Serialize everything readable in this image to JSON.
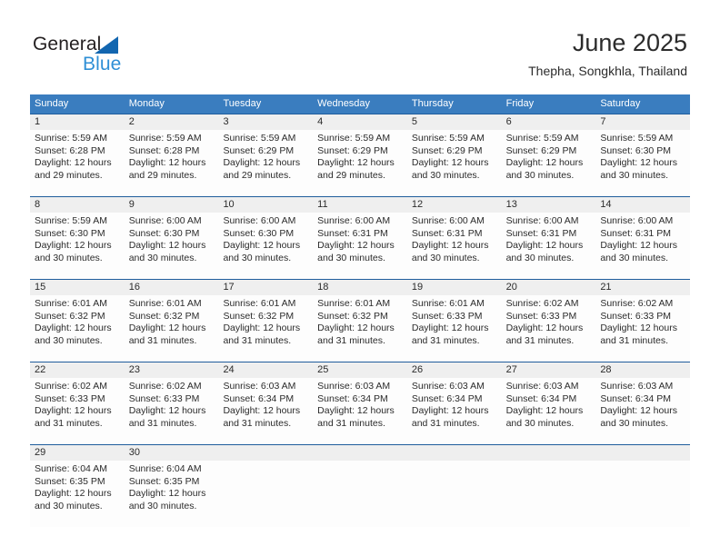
{
  "brand": {
    "name_part1": "General",
    "name_part2": "Blue",
    "triangle_color": "#1266b0",
    "blue_text_color": "#2f8fd6"
  },
  "header": {
    "title": "June 2025",
    "subtitle": "Thepha, Songkhla, Thailand"
  },
  "colors": {
    "header_band": "#3a7dbf",
    "week_separator": "#1f5d9c",
    "day_number_band": "#efefef",
    "text": "#2b2b2b"
  },
  "weekdays": [
    "Sunday",
    "Monday",
    "Tuesday",
    "Wednesday",
    "Thursday",
    "Friday",
    "Saturday"
  ],
  "weeks": [
    {
      "days": [
        {
          "number": "1",
          "sunrise": "Sunrise: 5:59 AM",
          "sunset": "Sunset: 6:28 PM",
          "daylight_line1": "Daylight: 12 hours",
          "daylight_line2": "and 29 minutes."
        },
        {
          "number": "2",
          "sunrise": "Sunrise: 5:59 AM",
          "sunset": "Sunset: 6:28 PM",
          "daylight_line1": "Daylight: 12 hours",
          "daylight_line2": "and 29 minutes."
        },
        {
          "number": "3",
          "sunrise": "Sunrise: 5:59 AM",
          "sunset": "Sunset: 6:29 PM",
          "daylight_line1": "Daylight: 12 hours",
          "daylight_line2": "and 29 minutes."
        },
        {
          "number": "4",
          "sunrise": "Sunrise: 5:59 AM",
          "sunset": "Sunset: 6:29 PM",
          "daylight_line1": "Daylight: 12 hours",
          "daylight_line2": "and 29 minutes."
        },
        {
          "number": "5",
          "sunrise": "Sunrise: 5:59 AM",
          "sunset": "Sunset: 6:29 PM",
          "daylight_line1": "Daylight: 12 hours",
          "daylight_line2": "and 30 minutes."
        },
        {
          "number": "6",
          "sunrise": "Sunrise: 5:59 AM",
          "sunset": "Sunset: 6:29 PM",
          "daylight_line1": "Daylight: 12 hours",
          "daylight_line2": "and 30 minutes."
        },
        {
          "number": "7",
          "sunrise": "Sunrise: 5:59 AM",
          "sunset": "Sunset: 6:30 PM",
          "daylight_line1": "Daylight: 12 hours",
          "daylight_line2": "and 30 minutes."
        }
      ]
    },
    {
      "days": [
        {
          "number": "8",
          "sunrise": "Sunrise: 5:59 AM",
          "sunset": "Sunset: 6:30 PM",
          "daylight_line1": "Daylight: 12 hours",
          "daylight_line2": "and 30 minutes."
        },
        {
          "number": "9",
          "sunrise": "Sunrise: 6:00 AM",
          "sunset": "Sunset: 6:30 PM",
          "daylight_line1": "Daylight: 12 hours",
          "daylight_line2": "and 30 minutes."
        },
        {
          "number": "10",
          "sunrise": "Sunrise: 6:00 AM",
          "sunset": "Sunset: 6:30 PM",
          "daylight_line1": "Daylight: 12 hours",
          "daylight_line2": "and 30 minutes."
        },
        {
          "number": "11",
          "sunrise": "Sunrise: 6:00 AM",
          "sunset": "Sunset: 6:31 PM",
          "daylight_line1": "Daylight: 12 hours",
          "daylight_line2": "and 30 minutes."
        },
        {
          "number": "12",
          "sunrise": "Sunrise: 6:00 AM",
          "sunset": "Sunset: 6:31 PM",
          "daylight_line1": "Daylight: 12 hours",
          "daylight_line2": "and 30 minutes."
        },
        {
          "number": "13",
          "sunrise": "Sunrise: 6:00 AM",
          "sunset": "Sunset: 6:31 PM",
          "daylight_line1": "Daylight: 12 hours",
          "daylight_line2": "and 30 minutes."
        },
        {
          "number": "14",
          "sunrise": "Sunrise: 6:00 AM",
          "sunset": "Sunset: 6:31 PM",
          "daylight_line1": "Daylight: 12 hours",
          "daylight_line2": "and 30 minutes."
        }
      ]
    },
    {
      "days": [
        {
          "number": "15",
          "sunrise": "Sunrise: 6:01 AM",
          "sunset": "Sunset: 6:32 PM",
          "daylight_line1": "Daylight: 12 hours",
          "daylight_line2": "and 30 minutes."
        },
        {
          "number": "16",
          "sunrise": "Sunrise: 6:01 AM",
          "sunset": "Sunset: 6:32 PM",
          "daylight_line1": "Daylight: 12 hours",
          "daylight_line2": "and 31 minutes."
        },
        {
          "number": "17",
          "sunrise": "Sunrise: 6:01 AM",
          "sunset": "Sunset: 6:32 PM",
          "daylight_line1": "Daylight: 12 hours",
          "daylight_line2": "and 31 minutes."
        },
        {
          "number": "18",
          "sunrise": "Sunrise: 6:01 AM",
          "sunset": "Sunset: 6:32 PM",
          "daylight_line1": "Daylight: 12 hours",
          "daylight_line2": "and 31 minutes."
        },
        {
          "number": "19",
          "sunrise": "Sunrise: 6:01 AM",
          "sunset": "Sunset: 6:33 PM",
          "daylight_line1": "Daylight: 12 hours",
          "daylight_line2": "and 31 minutes."
        },
        {
          "number": "20",
          "sunrise": "Sunrise: 6:02 AM",
          "sunset": "Sunset: 6:33 PM",
          "daylight_line1": "Daylight: 12 hours",
          "daylight_line2": "and 31 minutes."
        },
        {
          "number": "21",
          "sunrise": "Sunrise: 6:02 AM",
          "sunset": "Sunset: 6:33 PM",
          "daylight_line1": "Daylight: 12 hours",
          "daylight_line2": "and 31 minutes."
        }
      ]
    },
    {
      "days": [
        {
          "number": "22",
          "sunrise": "Sunrise: 6:02 AM",
          "sunset": "Sunset: 6:33 PM",
          "daylight_line1": "Daylight: 12 hours",
          "daylight_line2": "and 31 minutes."
        },
        {
          "number": "23",
          "sunrise": "Sunrise: 6:02 AM",
          "sunset": "Sunset: 6:33 PM",
          "daylight_line1": "Daylight: 12 hours",
          "daylight_line2": "and 31 minutes."
        },
        {
          "number": "24",
          "sunrise": "Sunrise: 6:03 AM",
          "sunset": "Sunset: 6:34 PM",
          "daylight_line1": "Daylight: 12 hours",
          "daylight_line2": "and 31 minutes."
        },
        {
          "number": "25",
          "sunrise": "Sunrise: 6:03 AM",
          "sunset": "Sunset: 6:34 PM",
          "daylight_line1": "Daylight: 12 hours",
          "daylight_line2": "and 31 minutes."
        },
        {
          "number": "26",
          "sunrise": "Sunrise: 6:03 AM",
          "sunset": "Sunset: 6:34 PM",
          "daylight_line1": "Daylight: 12 hours",
          "daylight_line2": "and 31 minutes."
        },
        {
          "number": "27",
          "sunrise": "Sunrise: 6:03 AM",
          "sunset": "Sunset: 6:34 PM",
          "daylight_line1": "Daylight: 12 hours",
          "daylight_line2": "and 30 minutes."
        },
        {
          "number": "28",
          "sunrise": "Sunrise: 6:03 AM",
          "sunset": "Sunset: 6:34 PM",
          "daylight_line1": "Daylight: 12 hours",
          "daylight_line2": "and 30 minutes."
        }
      ]
    },
    {
      "days": [
        {
          "number": "29",
          "sunrise": "Sunrise: 6:04 AM",
          "sunset": "Sunset: 6:35 PM",
          "daylight_line1": "Daylight: 12 hours",
          "daylight_line2": "and 30 minutes."
        },
        {
          "number": "30",
          "sunrise": "Sunrise: 6:04 AM",
          "sunset": "Sunset: 6:35 PM",
          "daylight_line1": "Daylight: 12 hours",
          "daylight_line2": "and 30 minutes."
        },
        {
          "number": "",
          "sunrise": "",
          "sunset": "",
          "daylight_line1": "",
          "daylight_line2": ""
        },
        {
          "number": "",
          "sunrise": "",
          "sunset": "",
          "daylight_line1": "",
          "daylight_line2": ""
        },
        {
          "number": "",
          "sunrise": "",
          "sunset": "",
          "daylight_line1": "",
          "daylight_line2": ""
        },
        {
          "number": "",
          "sunrise": "",
          "sunset": "",
          "daylight_line1": "",
          "daylight_line2": ""
        },
        {
          "number": "",
          "sunrise": "",
          "sunset": "",
          "daylight_line1": "",
          "daylight_line2": ""
        }
      ]
    }
  ]
}
